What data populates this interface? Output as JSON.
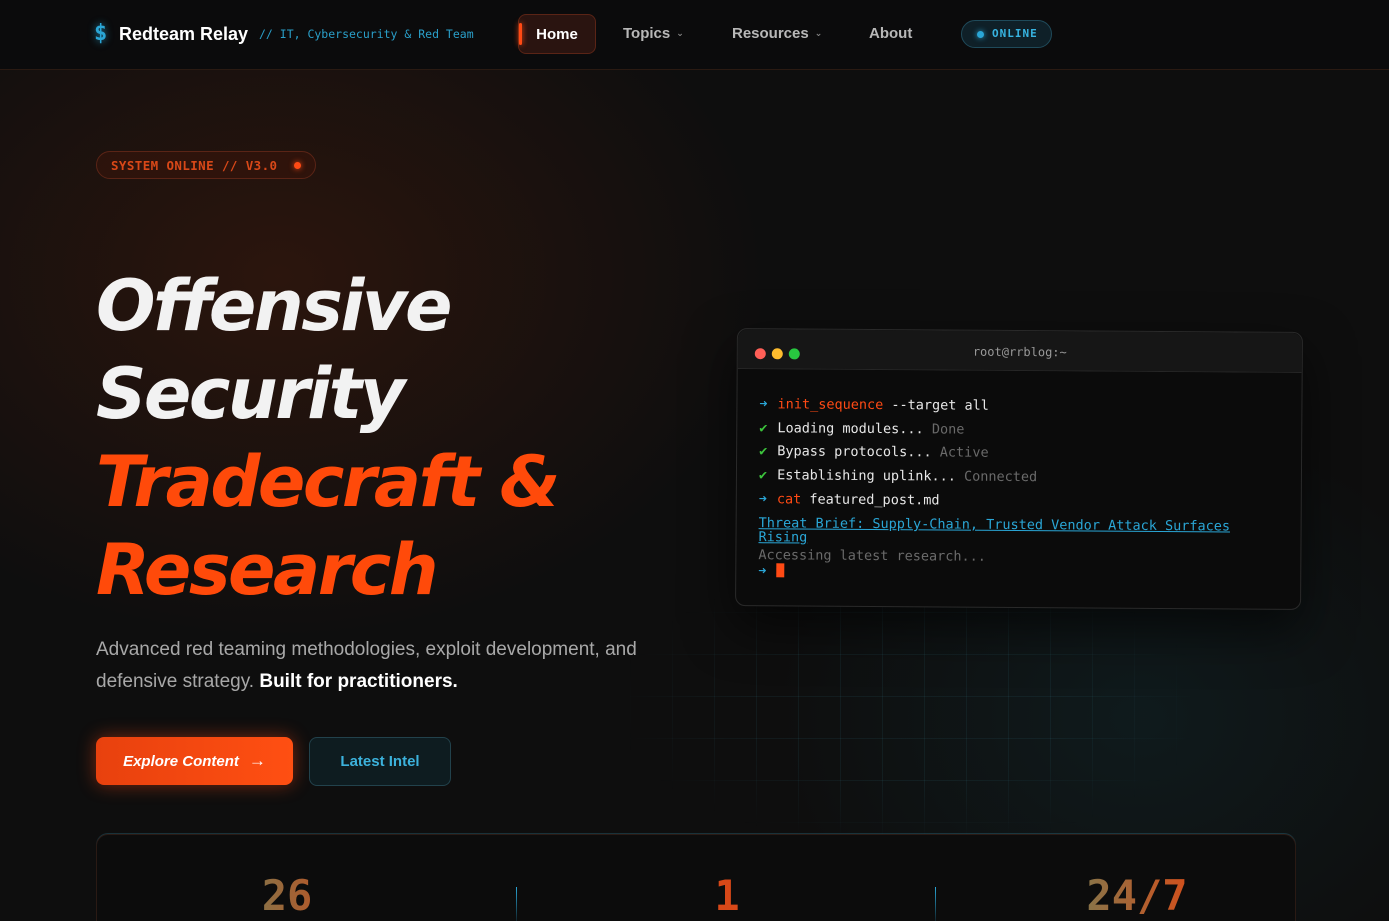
{
  "brand": {
    "icon": "dollar-sign-icon",
    "icon_glyph": "$",
    "name": "Redteam Relay",
    "tagline": "// IT, Cybersecurity & Red Team"
  },
  "nav": {
    "home": "Home",
    "topics": "Topics",
    "resources": "Resources",
    "about": "About",
    "status": "ONLINE"
  },
  "hero": {
    "badge": "SYSTEM ONLINE // V3.0",
    "title_line1": "Offensive",
    "title_line2": "Security",
    "title_line3": "Tradecraft &",
    "title_line4": "Research",
    "subtitle": "Advanced red teaming methodologies, exploit development, and defensive strategy.",
    "subtitle_bold": "Built for practitioners.",
    "cta_primary": "Explore Content",
    "cta_secondary": "Latest Intel"
  },
  "terminal": {
    "title": "root@rrblog:~",
    "lines": [
      {
        "cmd": "init_sequence",
        "rest": " --target all"
      },
      {
        "text": "Loading modules...",
        "status": "Done"
      },
      {
        "text": "Bypass protocols...",
        "status": "Active"
      },
      {
        "text": "Establishing uplink...",
        "status": "Connected"
      },
      {
        "cmd": "cat",
        "rest": " featured_post.md"
      }
    ],
    "link": "Threat Brief: Supply-Chain, Trusted Vendor Attack Surfaces Rising",
    "loading": "Accessing latest research..."
  },
  "stats": [
    "26",
    "1",
    "24/7"
  ],
  "colors": {
    "accent_orange": "#ff4a0a",
    "accent_cyan": "#2aa6d6",
    "background": "#0e0e0e"
  }
}
